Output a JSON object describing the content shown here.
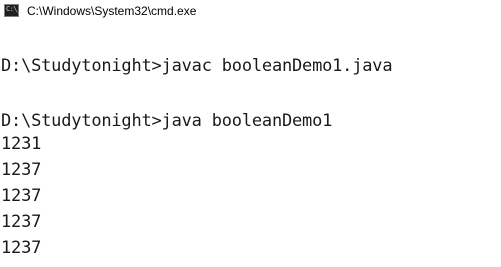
{
  "window": {
    "title": "C:\\Windows\\System32\\cmd.exe",
    "icon_text": "C:\\_",
    "icon": "cmd-console-icon"
  },
  "console": {
    "lines": [
      "D:\\Studytonight>javac booleanDemo1.java",
      "D:\\Studytonight>java booleanDemo1",
      "1231",
      "1237",
      "1237",
      "1237",
      "1237"
    ]
  }
}
